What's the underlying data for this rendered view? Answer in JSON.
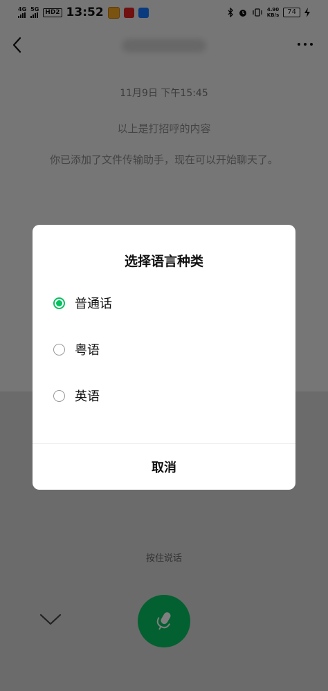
{
  "status_bar": {
    "signal_1": "4G",
    "signal_2": "5G",
    "hd_label": "HD2",
    "time": "13:52",
    "app_icons": [
      "weibo-icon",
      "toutiao-icon",
      "alipay-icon"
    ],
    "speed_value": "4.90",
    "speed_unit": "KB/s",
    "battery": "74"
  },
  "chat": {
    "timestamp": "11月9日 下午15:45",
    "messages": [
      "以上是打招呼的内容",
      "你已添加了文件传输助手，现在可以开始聊天了。"
    ]
  },
  "voice_panel": {
    "hold_to_talk": "按住说话"
  },
  "dialog": {
    "title": "选择语言种类",
    "options": [
      {
        "label": "普通话",
        "selected": true
      },
      {
        "label": "粤语",
        "selected": false
      },
      {
        "label": "英语",
        "selected": false
      }
    ],
    "cancel_label": "取消"
  },
  "colors": {
    "accent": "#07c160",
    "overlay": "rgba(0,0,0,0.5)"
  }
}
